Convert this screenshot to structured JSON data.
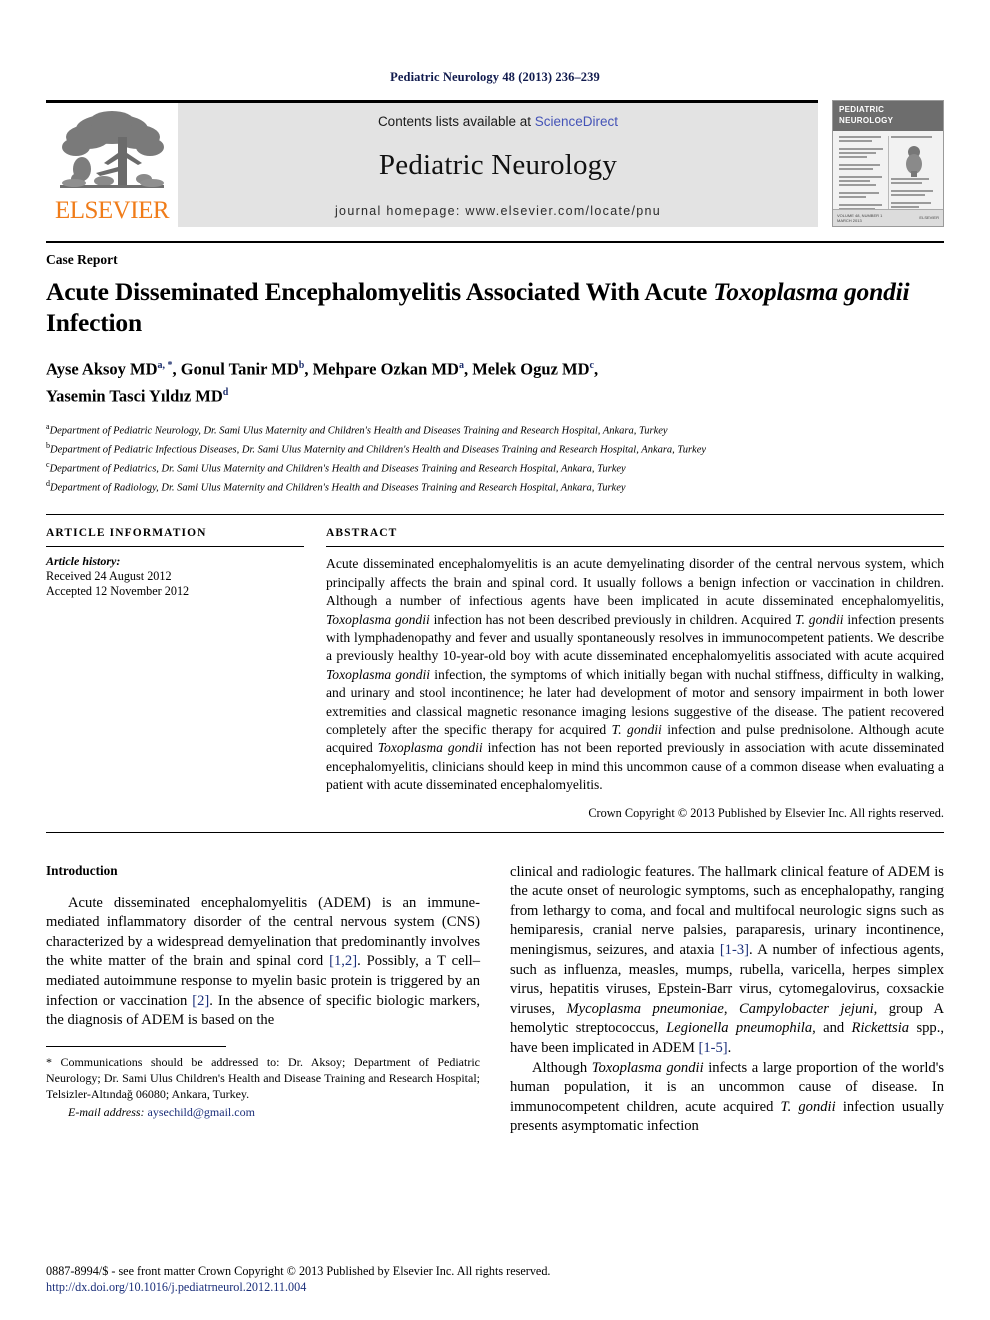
{
  "running_head": "Pediatric Neurology 48 (2013) 236–239",
  "masthead": {
    "publisher_name": "ELSEVIER",
    "contents_prefix": "Contents lists available at ",
    "sciencedirect_link": "ScienceDirect",
    "journal_name": "Pediatric Neurology",
    "homepage": "journal homepage: www.elsevier.com/locate/pnu",
    "cover": {
      "title_line1": "PEDIATRIC",
      "title_line2": "NEUROLOGY",
      "footer_left_line1": "VOLUME 48, NUMBER 1",
      "footer_left_line2": "MARCH 2013",
      "footer_right": "ELSEVIER"
    }
  },
  "article": {
    "doctype": "Case Report",
    "title_part1": "Acute Disseminated Encephalomyelitis Associated With Acute ",
    "title_italic1": "Toxoplasma gondii",
    "title_part2": " Infection",
    "authors_line1_a": "Ayse Aksoy MD",
    "authors_sup1": "a, *",
    "authors_line1_b": ", Gonul Tanir MD",
    "authors_sup2": "b",
    "authors_line1_c": ", Mehpare Ozkan MD",
    "authors_sup3": "a",
    "authors_line1_d": ", Melek Oguz MD",
    "authors_sup4": "c",
    "authors_line1_e": ",",
    "authors_line2_a": "Yasemin Tasci Yıldız MD",
    "authors_sup5": "d",
    "affiliations": [
      {
        "mark": "a",
        "text": "Department of Pediatric Neurology, Dr. Sami Ulus Maternity and Children's Health and Diseases Training and Research Hospital, Ankara, Turkey"
      },
      {
        "mark": "b",
        "text": "Department of Pediatric Infectious Diseases, Dr. Sami Ulus Maternity and Children's Health and Diseases Training and Research Hospital, Ankara, Turkey"
      },
      {
        "mark": "c",
        "text": "Department of Pediatrics, Dr. Sami Ulus Maternity and Children's Health and Diseases Training and Research Hospital, Ankara, Turkey"
      },
      {
        "mark": "d",
        "text": "Department of Radiology, Dr. Sami Ulus Maternity and Children's Health and Diseases Training and Research Hospital, Ankara, Turkey"
      }
    ]
  },
  "article_info": {
    "heading": "ARTICLE INFORMATION",
    "history_label": "Article history:",
    "received": "Received 24 August 2012",
    "accepted": "Accepted 12 November 2012"
  },
  "abstract": {
    "heading": "ABSTRACT",
    "p1": "Acute disseminated encephalomyelitis is an acute demyelinating disorder of the central nervous system, which principally affects the brain and spinal cord. It usually follows a benign infection or vaccination in children. Although a number of infectious agents have been implicated in acute disseminated encephalomyelitis, ",
    "i1": "Toxoplasma gondii",
    "p2": " infection has not been described previously in children. Acquired ",
    "i2": "T. gondii",
    "p3": " infection presents with lymphadenopathy and fever and usually spontaneously resolves in immunocompetent patients. We describe a previously healthy 10-year-old boy with acute disseminated encephalomyelitis associated with acute acquired ",
    "i3": "Toxoplasma gondii",
    "p4": " infection, the symptoms of which initially began with nuchal stiffness, difficulty in walking, and urinary and stool incontinence; he later had development of motor and sensory impairment in both lower extremities and classical magnetic resonance imaging lesions suggestive of the disease. The patient recovered completely after the specific therapy for acquired ",
    "i4": "T. gondii",
    "p5": " infection and pulse prednisolone. Although acute acquired ",
    "i5": "Toxoplasma gondii",
    "p6": " infection has not been reported previously in association with acute disseminated encephalomyelitis, clinicians should keep in mind this uncommon cause of a common disease when evaluating a patient with acute disseminated encephalomyelitis.",
    "copyright": "Crown Copyright © 2013 Published by Elsevier Inc. All rights reserved."
  },
  "body": {
    "intro_heading": "Introduction",
    "left_p1_a": "Acute disseminated encephalomyelitis (ADEM) is an immune-mediated inflammatory disorder of the central nervous system (CNS) characterized by a widespread demyelination that predominantly involves the white matter of the brain and spinal cord ",
    "left_ref1": "[1,2]",
    "left_p1_b": ". Possibly, a T cell–mediated autoimmune response to myelin basic protein is triggered by an infection or vaccination ",
    "left_ref2": "[2]",
    "left_p1_c": ". In the absence of specific biologic markers, the diagnosis of ADEM is based on the",
    "right_p1_a": "clinical and radiologic features. The hallmark clinical feature of ADEM is the acute onset of neurologic symptoms, such as encephalopathy, ranging from lethargy to coma, and focal and multifocal neurologic signs such as hemiparesis, cranial nerve palsies, paraparesis, urinary incontinence, meningismus, seizures, and ataxia ",
    "right_ref1": "[1-3]",
    "right_p1_b": ". A number of infectious agents, such as influenza, measles, mumps, rubella, varicella, herpes simplex virus, hepatitis viruses, Epstein-Barr virus, cytomegalovirus, coxsackie viruses, ",
    "right_i1": "Mycoplasma pneumoniae",
    "right_p1_c": ", ",
    "right_i2": "Campylobacter jejuni",
    "right_p1_d": ", group A hemolytic streptococcus, ",
    "right_i3": "Legionella pneumophila",
    "right_p1_e": ", and ",
    "right_i4": "Rickettsia",
    "right_p1_f": " spp., have been implicated in ADEM ",
    "right_ref2": "[1-5]",
    "right_p1_g": ".",
    "right_p2_a": "Although ",
    "right_p2_i1": "Toxoplasma gondii",
    "right_p2_b": " infects a large proportion of the world's human population, it is an uncommon cause of disease. In immunocompetent children, acute acquired ",
    "right_p2_i2": "T. gondii",
    "right_p2_c": " infection usually presents asymptomatic infection"
  },
  "footnote": {
    "text": "* Communications should be addressed to: Dr. Aksoy; Department of Pediatric Neurology; Dr. Sami Ulus Children's Health and Disease Training and Research Hospital; Telsizler-Altındağ 06080; Ankara, Turkey.",
    "email_label": "E-mail address:",
    "email": "aysechild@gmail.com"
  },
  "footer": {
    "issn": "0887-8994/$ - see front matter Crown Copyright © 2013 Published by Elsevier Inc. All rights reserved.",
    "doi": "http://dx.doi.org/10.1016/j.pediatrneurol.2012.11.004"
  }
}
